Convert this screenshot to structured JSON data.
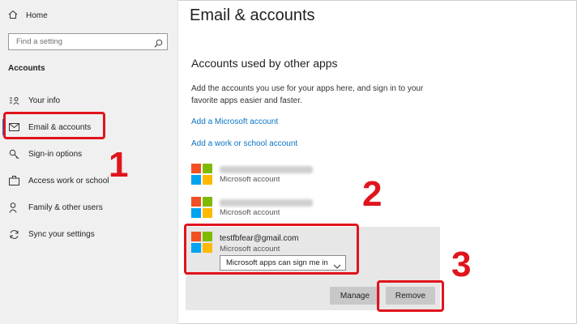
{
  "sidebar": {
    "home_label": "Home",
    "search_placeholder": "Find a setting",
    "section_label": "Accounts",
    "items": [
      {
        "label": "Your info",
        "icon": "person-card-icon"
      },
      {
        "label": "Email & accounts",
        "icon": "mail-icon",
        "selected": true
      },
      {
        "label": "Sign-in options",
        "icon": "key-icon"
      },
      {
        "label": "Access work or school",
        "icon": "briefcase-icon"
      },
      {
        "label": "Family & other users",
        "icon": "people-icon"
      },
      {
        "label": "Sync your settings",
        "icon": "sync-icon"
      }
    ]
  },
  "main": {
    "title": "Email & accounts",
    "subtitle": "Accounts used by other apps",
    "description": "Add the accounts you use for your apps here, and sign in to your favorite apps easier and faster.",
    "link_microsoft": "Add a Microsoft account",
    "link_work": "Add a work or school account",
    "accounts": [
      {
        "type": "Microsoft account"
      },
      {
        "type": "Microsoft account"
      }
    ],
    "selected_account": {
      "email": "testfbfear@gmail.com",
      "type": "Microsoft account",
      "dropdown_value": "Microsoft apps can sign me in"
    },
    "manage_button": "Manage",
    "remove_button": "Remove"
  },
  "annotations": {
    "step1": "1",
    "step2": "2",
    "step3": "3",
    "color": "#e0141c"
  },
  "colors": {
    "accent": "#0078d7",
    "link": "#0a74c4",
    "ms_red": "#f25022",
    "ms_green": "#7fba00",
    "ms_blue": "#00a4ef",
    "ms_yellow": "#ffb900"
  }
}
